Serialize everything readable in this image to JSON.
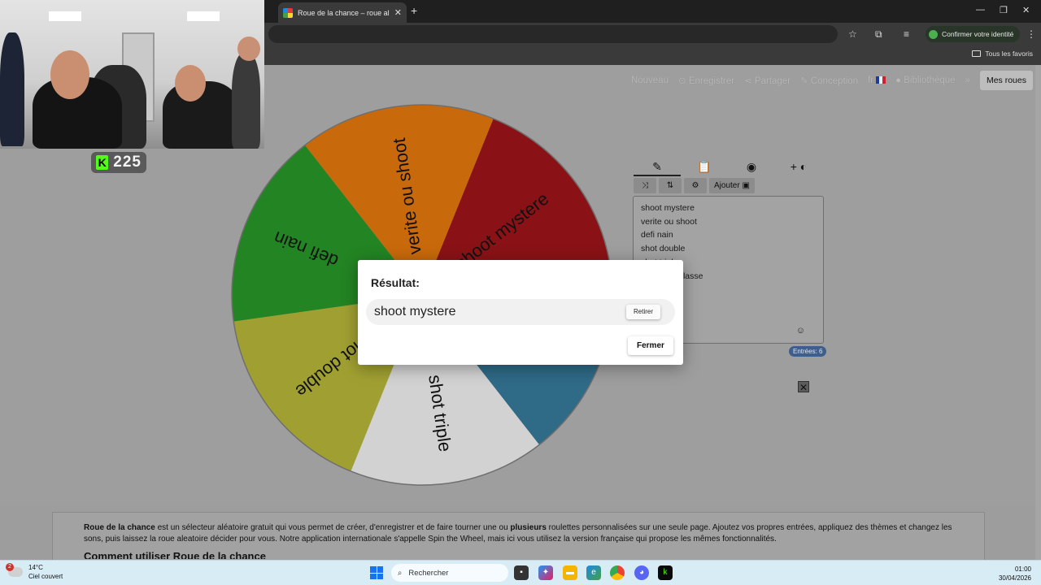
{
  "browser": {
    "tab_title": "Roue de la chance – roue aléatoire",
    "confirm_identity": "Confirmer votre identité",
    "all_favorites": "Tous les favoris"
  },
  "stream": {
    "viewer_count": "225"
  },
  "nav": {
    "new": "Nouveau",
    "save": "Enregistrer",
    "share": "Partager",
    "design": "Conception",
    "lang": "fr",
    "library": "Bibliothèque",
    "my_wheels": "Mes roues"
  },
  "panel": {
    "tab_icons": [
      "pencil-icon",
      "clipboard-icon",
      "eye-off-icon",
      "add-theme-icon"
    ],
    "add_button": "Ajouter",
    "entries": [
      "shoot mystere",
      "verite ou shoot",
      "defi nain",
      "shot double",
      "shot triple",
      "shot deguelasse"
    ],
    "entries_count": "Entrées: 6"
  },
  "wheel": {
    "segments": [
      {
        "label": "shoot mystere",
        "color": "#8a1216"
      },
      {
        "label": "shot deguelasse",
        "color": "#2f6a87"
      },
      {
        "label": "shot triple",
        "color": "#d2d2d2"
      },
      {
        "label": "shot double",
        "color": "#a0a032"
      },
      {
        "label": "defi nain",
        "color": "#238423"
      },
      {
        "label": "verite ou shoot",
        "color": "#c8690b"
      }
    ]
  },
  "dialog": {
    "title": "Résultat:",
    "result": "shoot mystere",
    "remove": "Retirer",
    "close": "Fermer"
  },
  "info": {
    "brand": "Roue de la chance",
    "text_a": " est un sélecteur aléatoire gratuit qui vous permet de créer, d'enregistrer et de faire tourner une ou ",
    "text_bold": "plusieurs",
    "text_b": " roulettes personnalisées sur une seule page. Ajoutez vos propres entrées, appliquez des thèmes et changez les sons, puis laissez la roue aleatoire décider pour vous. Notre application internationale s'appelle Spin the Wheel, mais ici vous utilisez la version française qui propose les mêmes fonctionnalités.",
    "heading": "Comment utiliser Roue de la chance"
  },
  "taskbar": {
    "temp": "14°C",
    "weather": "Ciel couvert",
    "weather_badge": "2",
    "search": "Rechercher",
    "time": "01:00",
    "date": "30/04/2026"
  }
}
